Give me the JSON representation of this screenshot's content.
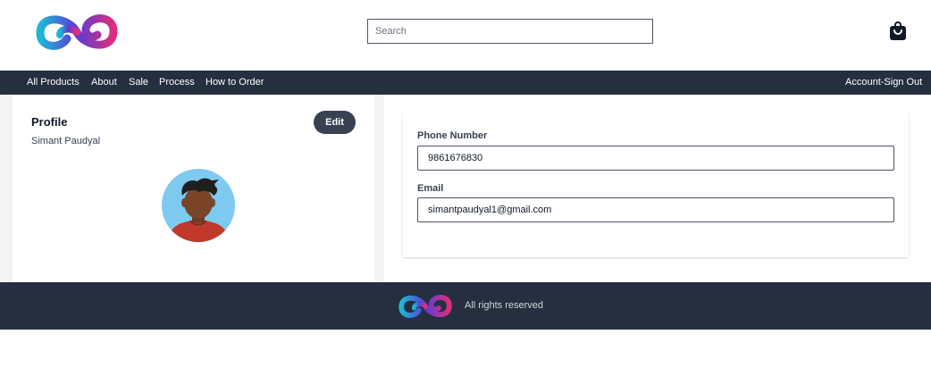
{
  "header": {
    "logo": "infinity-logo",
    "search": {
      "placeholder": "Search",
      "value": ""
    },
    "cart_icon": "shopping-bag-icon"
  },
  "nav": {
    "items": [
      {
        "label": "All Products"
      },
      {
        "label": "About"
      },
      {
        "label": "Sale"
      },
      {
        "label": "Process"
      },
      {
        "label": "How to Order"
      }
    ],
    "account_label": "Account-Sign Out"
  },
  "profile": {
    "title": "Profile",
    "name": "Simant Paudyal",
    "edit_label": "Edit",
    "avatar": "user-avatar-icon"
  },
  "details": {
    "phone_label": "Phone Number",
    "phone_value": "9861676830",
    "email_label": "Email",
    "email_value": "simantpaudyal1@gmail.com"
  },
  "footer": {
    "logo": "infinity-logo",
    "text": "All rights reserved"
  },
  "colors": {
    "nav_bg": "#252f3f",
    "button_bg": "#374151",
    "logo_blue": "#1fb5d8",
    "logo_purple": "#5b3bd6",
    "logo_pink": "#e02d7b"
  }
}
